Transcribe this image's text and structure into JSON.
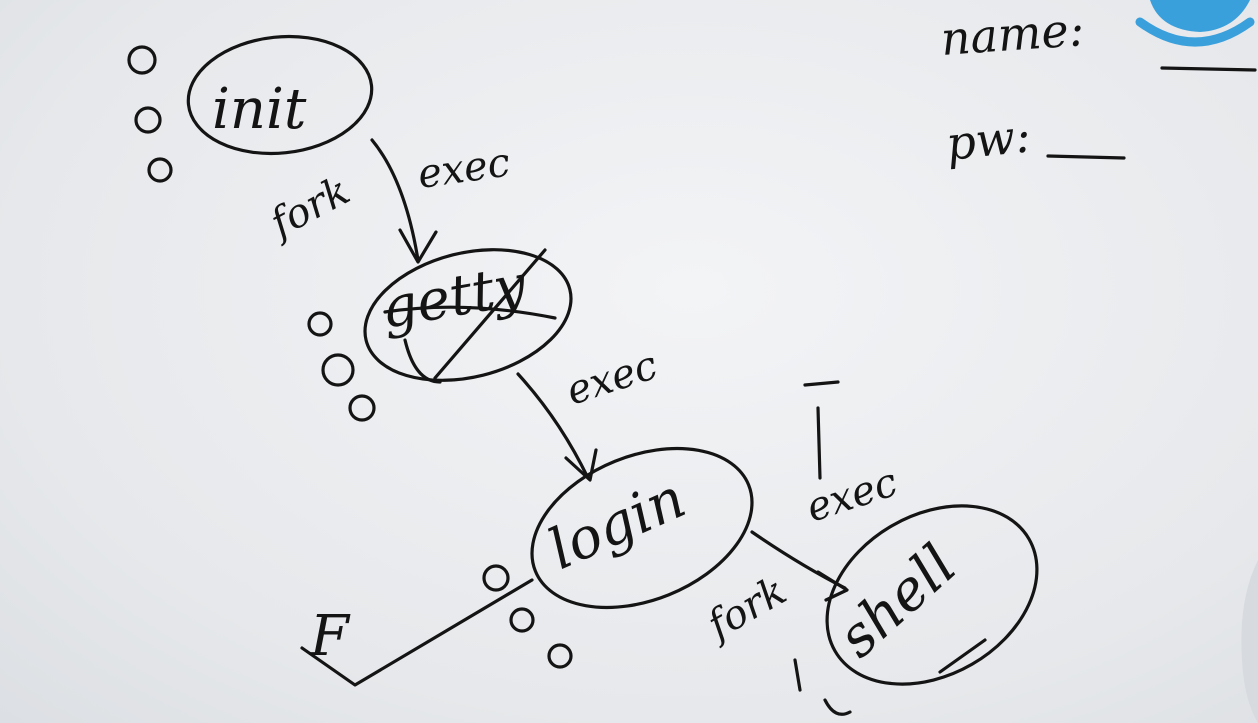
{
  "nodes": [
    {
      "id": "init",
      "label": "init"
    },
    {
      "id": "getty",
      "label": "getty"
    },
    {
      "id": "login",
      "label": "login"
    },
    {
      "id": "shell",
      "label": "shell"
    }
  ],
  "edges": [
    {
      "from": "init",
      "to": "getty",
      "labels": [
        "fork",
        "exec"
      ]
    },
    {
      "from": "getty",
      "to": "login",
      "labels": [
        "exec"
      ]
    },
    {
      "from": "login",
      "to": "shell",
      "labels": [
        "fork",
        "exec"
      ]
    }
  ],
  "side_marks": {
    "fail": "F"
  },
  "form": {
    "name_label": "name:",
    "pw_label": "pw:"
  },
  "colors": {
    "ink": "#141414",
    "board": "#eceef1",
    "logo": "#3aa0dc"
  },
  "icons": [
    "logo-icon"
  ]
}
